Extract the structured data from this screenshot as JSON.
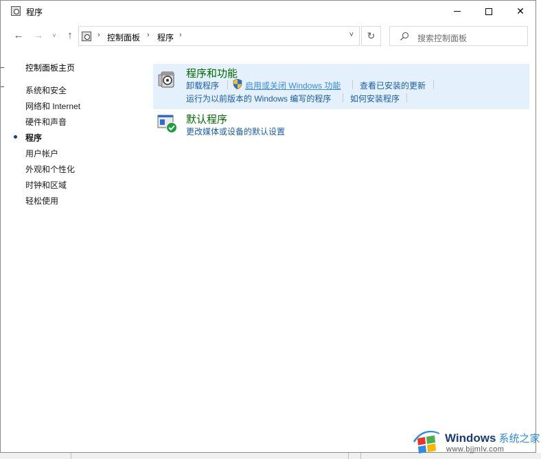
{
  "window": {
    "title": "程序",
    "controls": {
      "minimize_icon": "minimize-icon",
      "maximize_icon": "maximize-icon",
      "close_icon": "close-icon",
      "close_glyph": "✕"
    }
  },
  "nav": {
    "back_glyph": "←",
    "forward_glyph": "→",
    "recent_glyph": "˅",
    "up_glyph": "↑",
    "breadcrumb": [
      "控制面板",
      "程序"
    ],
    "crumb_separator": "›",
    "dropdown_glyph": "˅",
    "refresh_glyph": "↻",
    "search_placeholder": "搜索控制面板"
  },
  "sidebar": {
    "home": "控制面板主页",
    "items": [
      {
        "label": "系统和安全",
        "active": false
      },
      {
        "label": "网络和 Internet",
        "active": false
      },
      {
        "label": "硬件和声音",
        "active": false
      },
      {
        "label": "程序",
        "active": true
      },
      {
        "label": "用户帐户",
        "active": false
      },
      {
        "label": "外观和个性化",
        "active": false
      },
      {
        "label": "时钟和区域",
        "active": false
      },
      {
        "label": "轻松使用",
        "active": false
      }
    ]
  },
  "categories": [
    {
      "title": "程序和功能",
      "icon": "programs-features-icon",
      "links": [
        {
          "label": "卸载程序"
        },
        {
          "label": "启用或关闭 Windows 功能",
          "shield": true,
          "hovered": true
        },
        {
          "label": "查看已安装的更新"
        },
        {
          "label": "运行为以前版本的 Windows 编写的程序"
        },
        {
          "label": "如何安装程序"
        }
      ]
    },
    {
      "title": "默认程序",
      "icon": "default-programs-icon",
      "links": [
        {
          "label": "更改媒体或设备的默认设置"
        }
      ]
    }
  ],
  "colors": {
    "category_title": "#006a00",
    "link": "#1a5da8",
    "highlight_bg": "#e4f0fb"
  },
  "watermark": {
    "brand": "Windows",
    "brand_cn": "系统之家",
    "url": "www.bjjmlv.com"
  }
}
